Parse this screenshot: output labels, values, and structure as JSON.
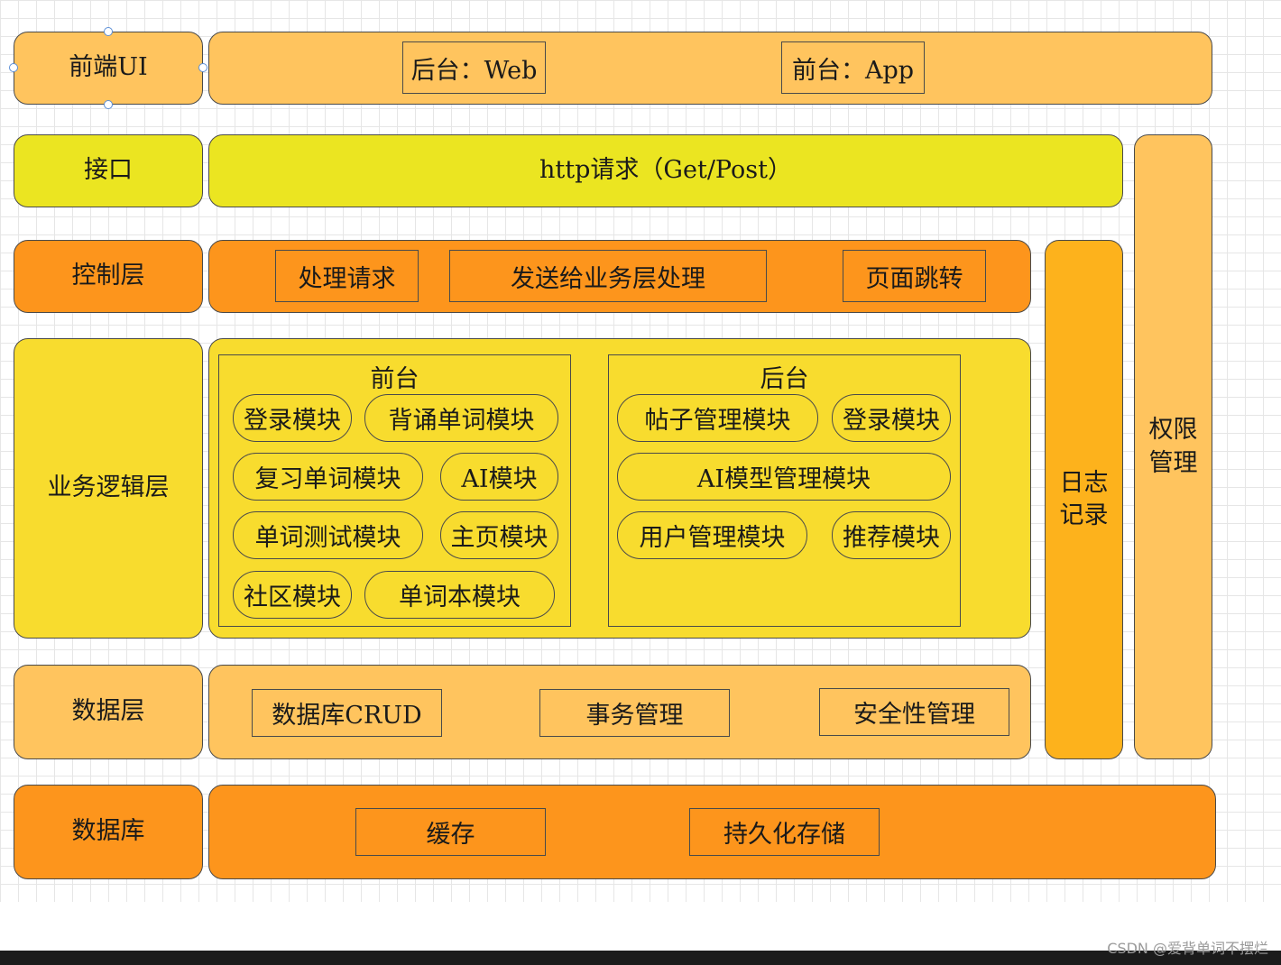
{
  "colors": {
    "light_orange": "#ffc45e",
    "yellow_green": "#ebe521",
    "orange": "#fd951c",
    "yellow": "#f8dc2e",
    "amber": "#fdb21c"
  },
  "layers": {
    "frontend": {
      "label": "前端UI",
      "items": [
        "后台：Web",
        "前台：App"
      ]
    },
    "interface": {
      "label": "接口",
      "content": "http请求（Get/Post）"
    },
    "control": {
      "label": "控制层",
      "items": [
        "处理请求",
        "发送给业务层处理",
        "页面跳转"
      ]
    },
    "business": {
      "label": "业务逻辑层",
      "front": {
        "title": "前台",
        "modules": [
          "登录模块",
          "背诵单词模块",
          "复习单词模块",
          "AI模块",
          "单词测试模块",
          "主页模块",
          "社区模块",
          "单词本模块"
        ]
      },
      "back": {
        "title": "后台",
        "modules": [
          "帖子管理模块",
          "登录模块",
          "AI模型管理模块",
          "用户管理模块",
          "推荐模块"
        ]
      }
    },
    "data": {
      "label": "数据层",
      "items": [
        "数据库CRUD",
        "事务管理",
        "安全性管理"
      ]
    },
    "database": {
      "label": "数据库",
      "items": [
        "缓存",
        "持久化存储"
      ]
    }
  },
  "side": {
    "log": [
      "日志",
      "记录"
    ],
    "permission": [
      "权限",
      "管理"
    ]
  },
  "watermark": "CSDN @爱背单词不摆烂"
}
